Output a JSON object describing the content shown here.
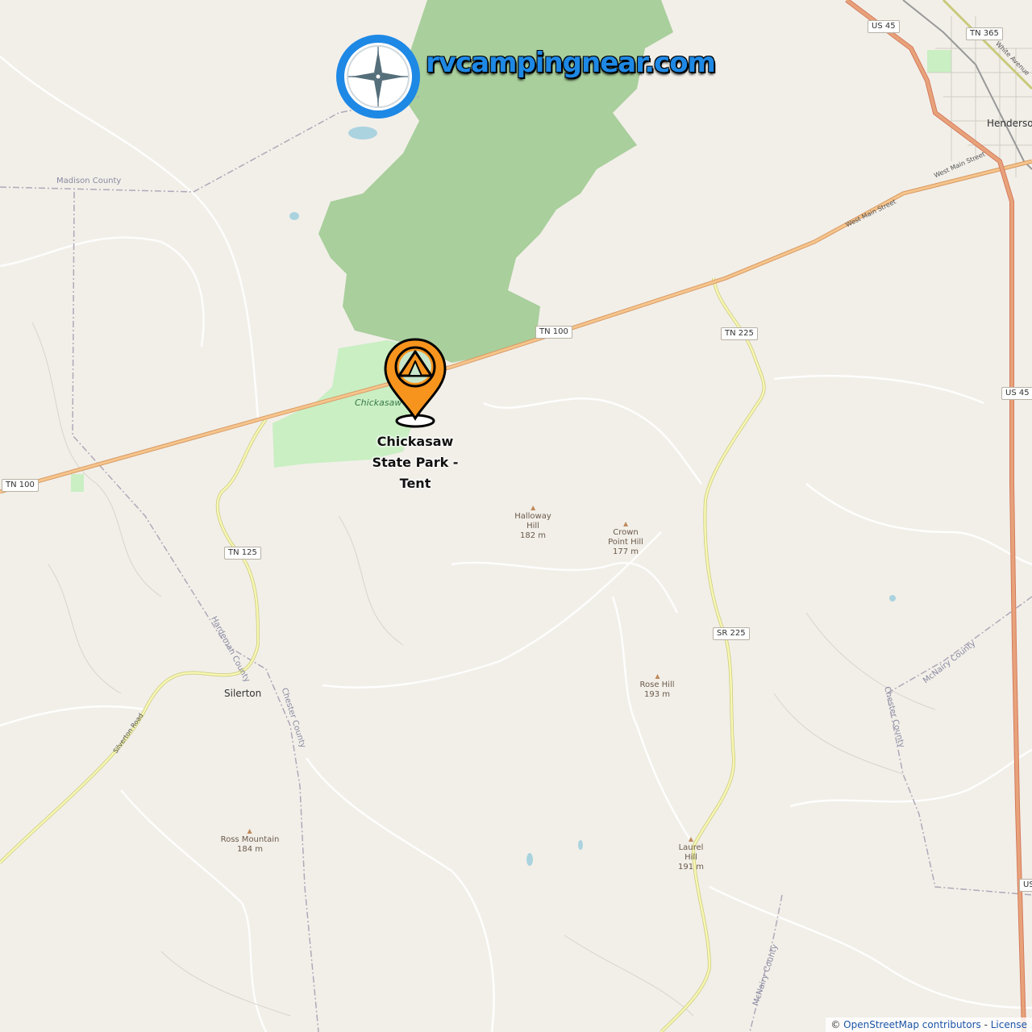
{
  "brand": {
    "name": "rvcampingnear.com",
    "icon": "compass-icon"
  },
  "marker": {
    "icon": "tent-icon",
    "label": "Chickasaw State Park - Tent",
    "color": "#f7941d"
  },
  "park_label": "Chickasaw",
  "attribution": {
    "copyright": "©",
    "text": "OpenStreetMap contributors",
    "separator": " - ",
    "license": "License"
  },
  "shields": {
    "us45_top": "US 45",
    "tn365": "TN 365",
    "tn100_center": "TN 100",
    "tn225": "TN 225",
    "us45_right": "US 45",
    "tn100_left": "TN 100",
    "tn125": "TN 125",
    "sr225": "SR 225",
    "us_edge": "US"
  },
  "roads": {
    "white_avenue": "White Avenue",
    "west_main_1": "West Main Street",
    "west_main_2": "West Main Street",
    "silverton": "Silverton Road"
  },
  "counties": {
    "madison": "Madison County",
    "hardeman": "Hardeman County",
    "chester_1": "Chester County",
    "mcnairy_1": "McNairy County",
    "chester_2": "Chester County",
    "mcnairy_2": "McNairy County"
  },
  "towns": {
    "henderson": "Henderso",
    "silerton": "Silerton"
  },
  "peaks": {
    "halloway": {
      "name1": "Halloway",
      "name2": "Hill",
      "elev": "182 m"
    },
    "crown": {
      "name1": "Crown",
      "name2": "Point Hill",
      "elev": "177 m"
    },
    "rose": {
      "name1": "Rose Hill",
      "elev": "193 m"
    },
    "laurel": {
      "name1": "Laurel",
      "name2": "Hill",
      "elev": "191 m"
    },
    "ross": {
      "name1": "Ross Mountain",
      "elev": "184 m"
    }
  },
  "colors": {
    "forest": "#a9cf9c",
    "park": "#c9efc3",
    "trunk": "#e8a27a",
    "primary": "#f5c58c",
    "secondary": "#f2f2a6",
    "background": "#f2efe9",
    "water": "#aad3df"
  }
}
